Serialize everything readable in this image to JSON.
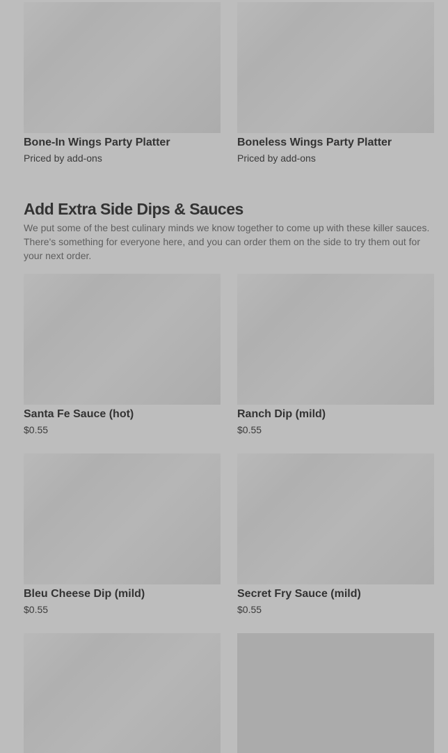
{
  "platters": [
    {
      "title": "Bone-In Wings Party Platter",
      "price": "Priced by add-ons"
    },
    {
      "title": "Boneless Wings Party Platter",
      "price": "Priced by add-ons"
    }
  ],
  "section": {
    "title": "Add Extra Side Dips & Sauces",
    "description": "We put some of the best culinary minds we know together to come up with these killer sauces. There's something for everyone here, and you can order them on the side to try them out for your next order."
  },
  "sauces": [
    {
      "title": "Santa Fe Sauce (hot)",
      "price": "$0.55"
    },
    {
      "title": "Ranch Dip (mild)",
      "price": "$0.55"
    },
    {
      "title": "Bleu Cheese Dip (mild)",
      "price": "$0.55"
    },
    {
      "title": "Secret Fry Sauce (mild)",
      "price": "$0.55"
    }
  ]
}
